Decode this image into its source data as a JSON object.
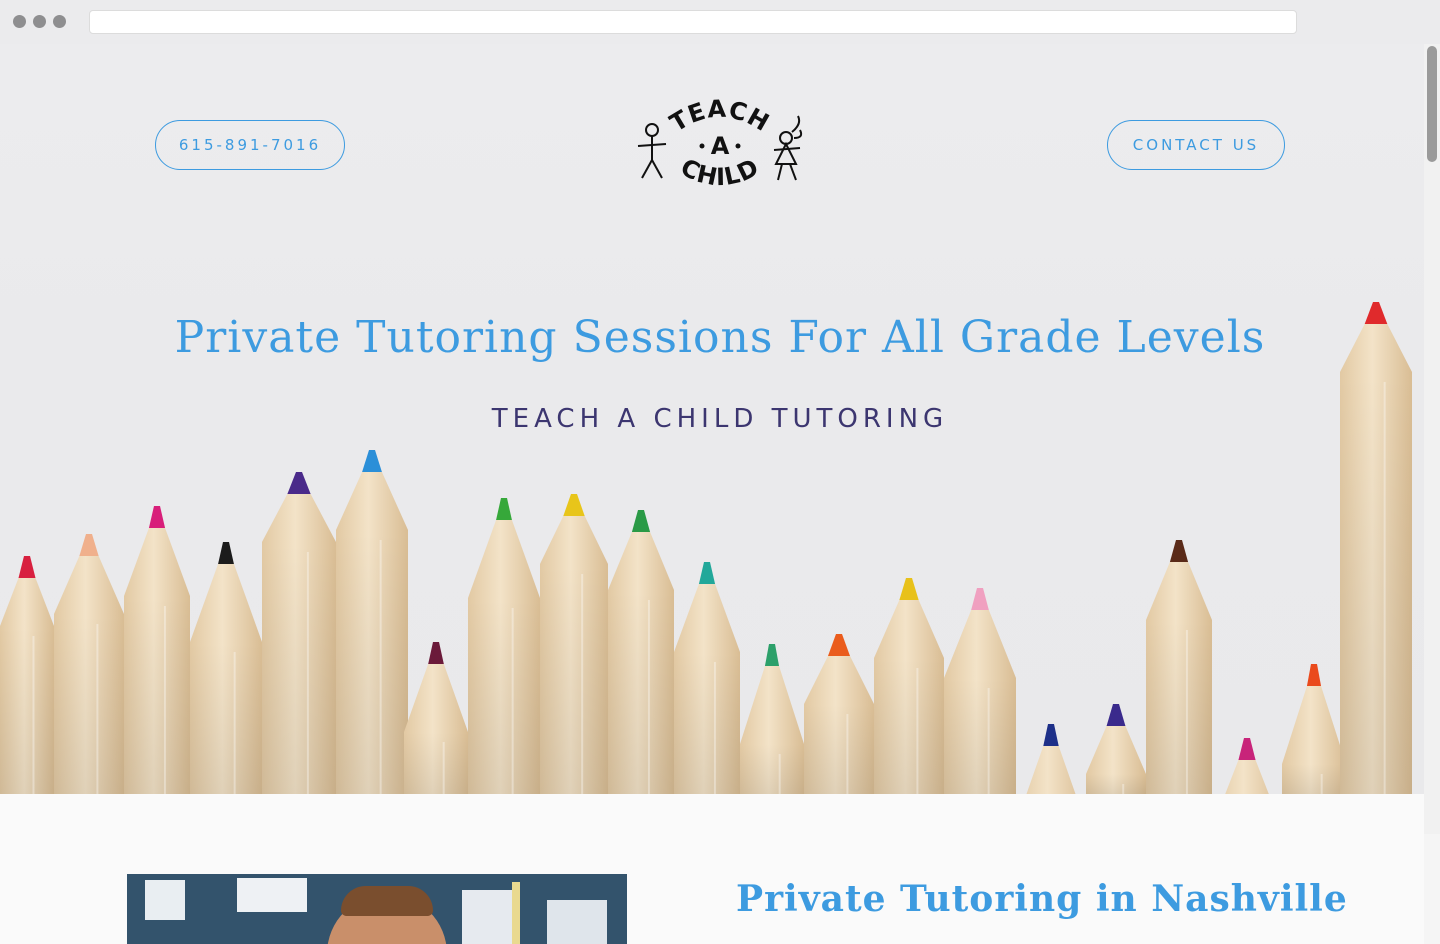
{
  "header": {
    "phone_label": "615-891-7016",
    "contact_label": "CONTACT US",
    "logo_top": "TEACH",
    "logo_mid": "A",
    "logo_bottom": "CHILD"
  },
  "hero": {
    "title": "Private Tutoring Sessions For All Grade Levels",
    "subtitle": "TEACH A CHILD TUTORING"
  },
  "section": {
    "title": "Private Tutoring in Nashville"
  },
  "colors": {
    "accent": "#3d9be0",
    "subtitle": "#3c3670"
  }
}
